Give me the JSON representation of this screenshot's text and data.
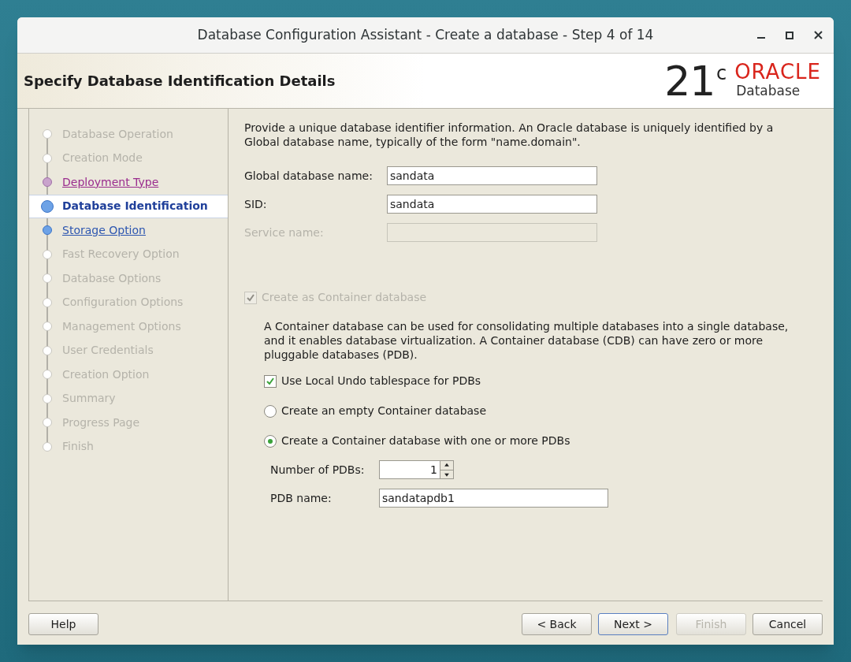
{
  "window": {
    "title": "Database Configuration Assistant - Create a database - Step 4 of 14"
  },
  "header": {
    "title": "Specify Database Identification Details",
    "logo": {
      "version": "21",
      "superscript": "c",
      "brand": "ORACLE",
      "product": "Database"
    }
  },
  "steps": [
    {
      "label": "Database Operation",
      "selected": false,
      "enabled": false,
      "visited": false
    },
    {
      "label": "Creation Mode",
      "selected": false,
      "enabled": false,
      "visited": false
    },
    {
      "label": "Deployment Type",
      "selected": false,
      "enabled": true,
      "visited": true
    },
    {
      "label": "Database Identification",
      "selected": true,
      "enabled": true,
      "visited": false
    },
    {
      "label": "Storage Option",
      "selected": false,
      "enabled": true,
      "visited": false
    },
    {
      "label": "Fast Recovery Option",
      "selected": false,
      "enabled": false,
      "visited": false
    },
    {
      "label": "Database Options",
      "selected": false,
      "enabled": false,
      "visited": false
    },
    {
      "label": "Configuration Options",
      "selected": false,
      "enabled": false,
      "visited": false
    },
    {
      "label": "Management Options",
      "selected": false,
      "enabled": false,
      "visited": false
    },
    {
      "label": "User Credentials",
      "selected": false,
      "enabled": false,
      "visited": false
    },
    {
      "label": "Creation Option",
      "selected": false,
      "enabled": false,
      "visited": false
    },
    {
      "label": "Summary",
      "selected": false,
      "enabled": false,
      "visited": false
    },
    {
      "label": "Progress Page",
      "selected": false,
      "enabled": false,
      "visited": false
    },
    {
      "label": "Finish",
      "selected": false,
      "enabled": false,
      "visited": false
    }
  ],
  "intro": "Provide a unique database identifier information. An Oracle database is uniquely identified by a Global database name, typically of the form \"name.domain\".",
  "fields": [
    {
      "label": "Global database name:",
      "value": "sandata",
      "disabled": false
    },
    {
      "label": "SID:",
      "value": "sandata",
      "disabled": false
    },
    {
      "label": "Service name:",
      "disabled": true
    }
  ],
  "container": {
    "label": "Create as Container database",
    "checked": true,
    "disabled": true,
    "description": "A Container database can be used for consolidating multiple databases into a single database, and it enables database virtualization. A Container database (CDB) can have zero or more pluggable databases (PDB).",
    "local_undo": {
      "label": "Use Local Undo tablespace for PDBs",
      "checked": true
    },
    "options": [
      {
        "label": "Create an empty Container database",
        "selected": false
      },
      {
        "label": "Create a Container database with one or more PDBs",
        "selected": true
      }
    ],
    "pdb_count": {
      "label": "Number of PDBs:",
      "value": "1"
    },
    "pdb_name": {
      "label": "PDB name:",
      "value": "sandatapdb1"
    }
  },
  "buttons": [
    {
      "label": "Help",
      "kind": "left",
      "disabled": false
    },
    {
      "label": "< Back",
      "kind": "right",
      "disabled": false
    },
    {
      "label": "Next >",
      "kind": "default",
      "disabled": false
    },
    {
      "label": "Finish",
      "kind": "right",
      "disabled": true
    },
    {
      "label": "Cancel",
      "kind": "right",
      "disabled": false
    }
  ]
}
